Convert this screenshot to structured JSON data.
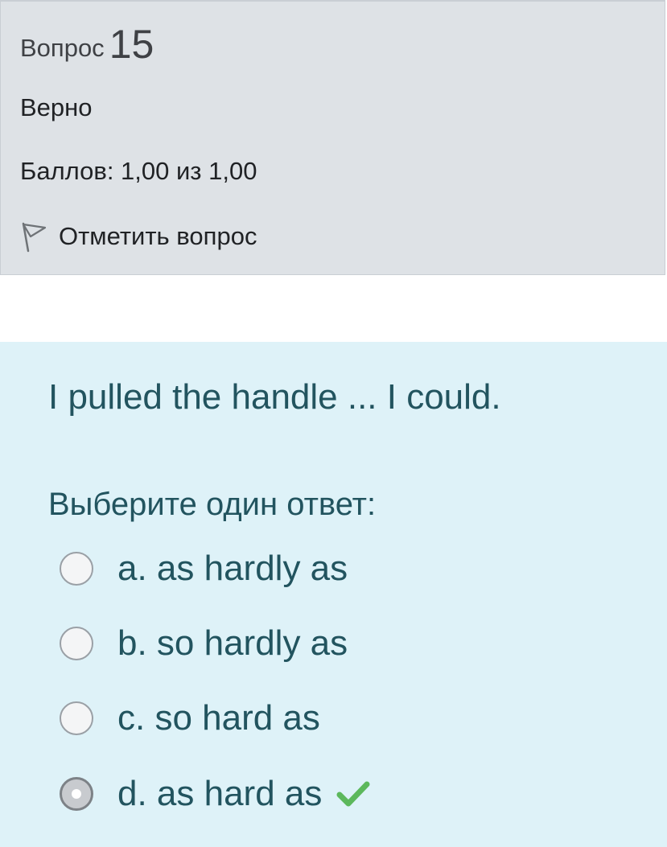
{
  "info": {
    "question_label": "Вопрос",
    "question_number": "15",
    "state": "Верно",
    "grade": "Баллов: 1,00 из 1,00",
    "flag_label": "Отметить вопрос"
  },
  "question": {
    "text": "I pulled the handle ... I could.",
    "prompt": "Выберите один ответ:",
    "answers": [
      {
        "label": "a. as hardly as",
        "selected": false
      },
      {
        "label": "b. so hardly as",
        "selected": false
      },
      {
        "label": "c. so hard as",
        "selected": false
      },
      {
        "label": "d. as hard as",
        "selected": true,
        "correct": true
      }
    ]
  },
  "colors": {
    "info_bg": "#dee2e6",
    "content_bg": "#def2f8",
    "text_teal": "#22545f",
    "check_green": "#5cb85c"
  },
  "icons": {
    "flag": "flag-outline-icon",
    "correct": "checkmark-icon"
  }
}
